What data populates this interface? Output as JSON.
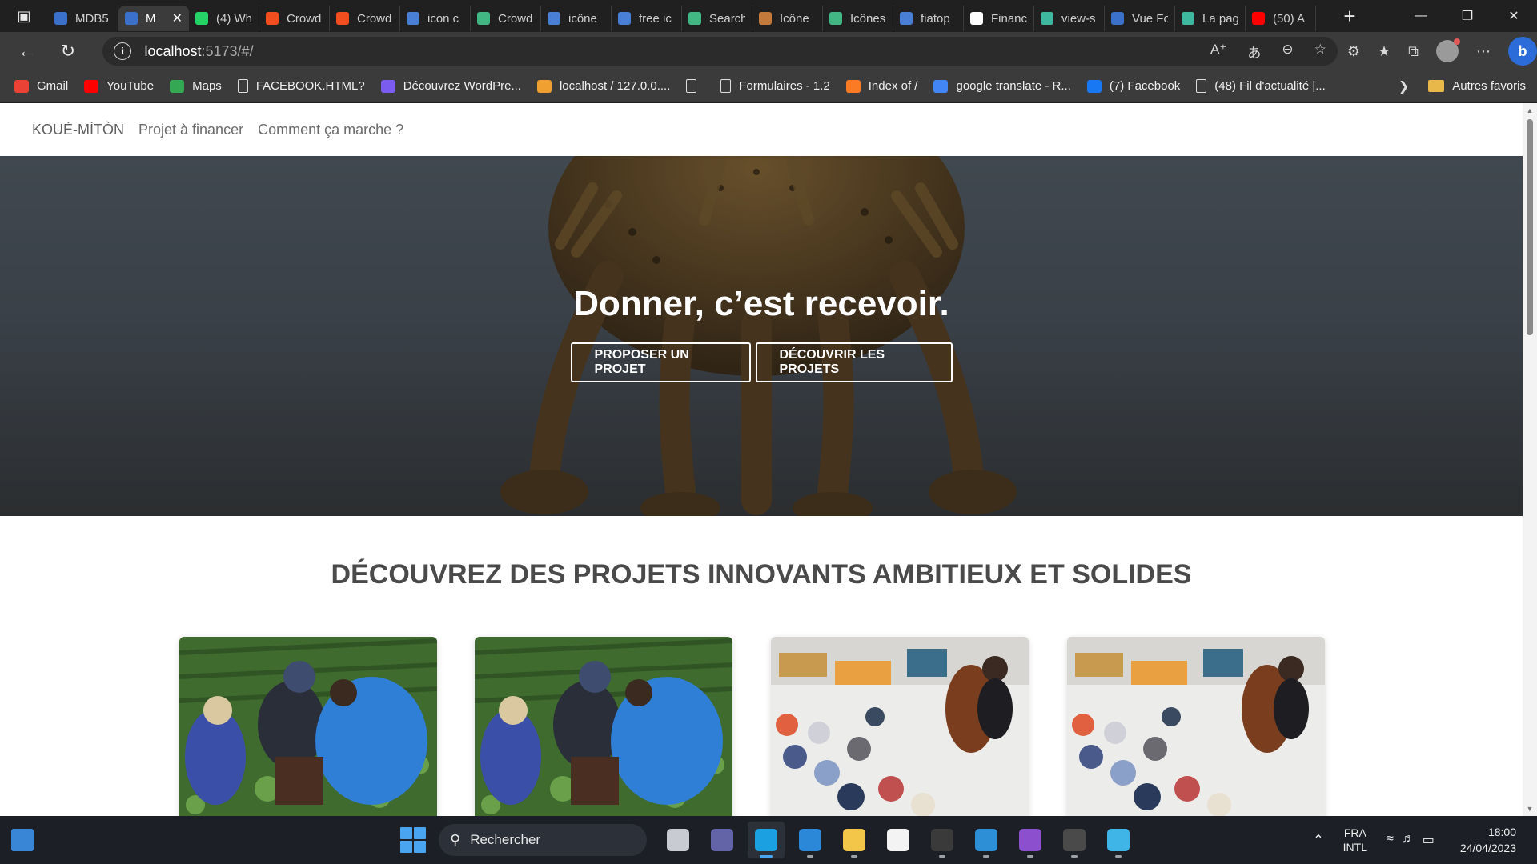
{
  "browser": {
    "tabs": [
      {
        "label": "MDB5",
        "color": "#3b71ca",
        "active": false
      },
      {
        "label": "M",
        "color": "#3b71ca",
        "active": true
      },
      {
        "label": "(4) Wh",
        "color": "#25d366",
        "active": false
      },
      {
        "label": "Crowd",
        "color": "#f24e1e",
        "active": false
      },
      {
        "label": "Crowd",
        "color": "#f24e1e",
        "active": false
      },
      {
        "label": "icon c",
        "color": "#4a7fd8",
        "active": false
      },
      {
        "label": "Crowd",
        "color": "#41b883",
        "active": false
      },
      {
        "label": "icône",
        "color": "#4a7fd8",
        "active": false
      },
      {
        "label": "free ic",
        "color": "#4a7fd8",
        "active": false
      },
      {
        "label": "Search",
        "color": "#41b883",
        "active": false
      },
      {
        "label": "Icône",
        "color": "#c47a3b",
        "active": false
      },
      {
        "label": "Icônes",
        "color": "#41b883",
        "active": false
      },
      {
        "label": "fiatop",
        "color": "#4a7fd8",
        "active": false
      },
      {
        "label": "Financ",
        "color": "#ffffff",
        "active": false
      },
      {
        "label": "view-s",
        "color": "#3fb8a0",
        "active": false
      },
      {
        "label": "Vue Fo",
        "color": "#3b71ca",
        "active": false
      },
      {
        "label": "La pag",
        "color": "#3fb8a0",
        "active": false
      },
      {
        "label": "(50) A",
        "color": "#ff0000",
        "active": false
      }
    ],
    "active_tab_close": "✕",
    "new_tab": "+",
    "url_host": "localhost",
    "url_rest": ":5173/#/",
    "bookmarks": [
      {
        "label": "Gmail",
        "color": "#ea4335",
        "doc": false
      },
      {
        "label": "YouTube",
        "color": "#ff0000",
        "doc": false
      },
      {
        "label": "Maps",
        "color": "#34a853",
        "doc": false
      },
      {
        "label": "FACEBOOK.HTML?",
        "color": "",
        "doc": true
      },
      {
        "label": "Découvrez WordPre...",
        "color": "#7b5cf0",
        "doc": false
      },
      {
        "label": "localhost / 127.0.0....",
        "color": "#f0a030",
        "doc": false
      },
      {
        "label": "",
        "color": "",
        "doc": true
      },
      {
        "label": "Formulaires - 1.2",
        "color": "",
        "doc": true
      },
      {
        "label": "Index of /",
        "color": "#fb7a24",
        "doc": false
      },
      {
        "label": "google translate - R...",
        "color": "#4285f4",
        "doc": false
      },
      {
        "label": "(7) Facebook",
        "color": "#1877f2",
        "doc": false
      },
      {
        "label": "(48) Fil d'actualité |...",
        "color": "",
        "doc": true
      }
    ],
    "other_favorites": "Autres favoris"
  },
  "site": {
    "nav": {
      "brand": "KOUÈ-MÌTÒN",
      "links": [
        "Projet à financer",
        "Comment ça marche ?"
      ]
    },
    "hero": {
      "headline": "Donner, c’est recevoir.",
      "btn_propose": "PROPOSER UN PROJET",
      "btn_discover": "DÉCOUVRIR LES PROJETS"
    },
    "section_title": "DÉCOUVREZ DES PROJETS INNOVANTS AMBITIEUX ET SOLIDES"
  },
  "taskbar": {
    "search_placeholder": "Rechercher",
    "lang_line1": "FRA",
    "lang_line2": "INTL",
    "time": "18:00",
    "date": "24/04/2023",
    "apps": [
      {
        "name": "task-view",
        "color": "#c8ccd2"
      },
      {
        "name": "teams",
        "color": "#6264a7"
      },
      {
        "name": "edge",
        "color": "#1ba1e2"
      },
      {
        "name": "mail",
        "color": "#2b88d8"
      },
      {
        "name": "file-explorer",
        "color": "#f3c64a"
      },
      {
        "name": "store",
        "color": "#f3f3f3"
      },
      {
        "name": "terminal",
        "color": "#3a3a3a"
      },
      {
        "name": "vscode",
        "color": "#2d8fd6"
      },
      {
        "name": "visual-studio",
        "color": "#8c4fce"
      },
      {
        "name": "terminal-2",
        "color": "#4a4a4a"
      },
      {
        "name": "notepad",
        "color": "#3fb4e6"
      }
    ]
  }
}
